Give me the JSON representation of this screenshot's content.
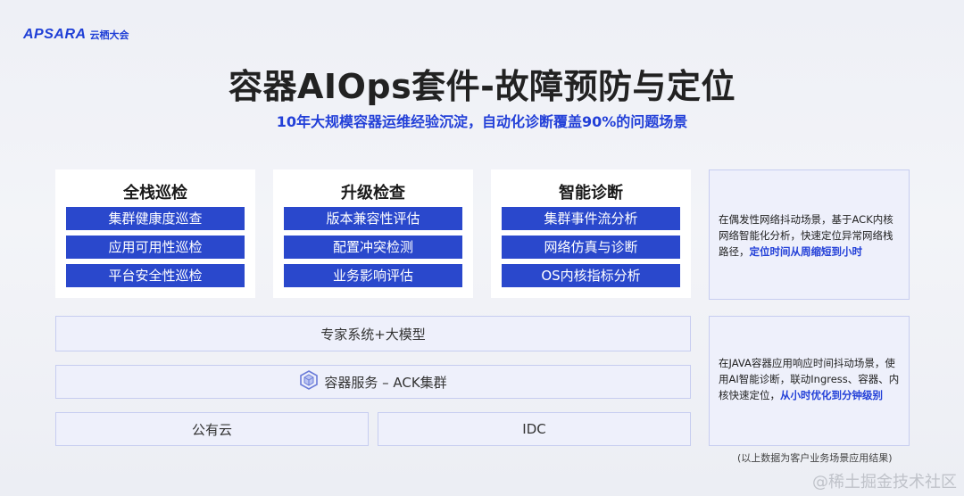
{
  "logo": {
    "brand": "APSARA",
    "event": "云栖大会"
  },
  "title": "容器AIOps套件-故障预防与定位",
  "subtitle": "10年大规模容器运维经验沉淀，自动化诊断覆盖90%的问题场景",
  "cards": [
    {
      "title": "全栈巡检",
      "items": [
        "集群健康度巡查",
        "应用可用性巡检",
        "平台安全性巡检"
      ]
    },
    {
      "title": "升级检查",
      "items": [
        "版本兼容性评估",
        "配置冲突检测",
        "业务影响评估"
      ]
    },
    {
      "title": "智能诊断",
      "items": [
        "集群事件流分析",
        "网络仿真与诊断",
        "OS内核指标分析"
      ]
    }
  ],
  "notes": [
    {
      "text": "在偶发性网络抖动场景，基于ACK内核网络智能化分析，快速定位异常网络栈路径，",
      "highlight": "定位时间从周缩短到小时"
    },
    {
      "text": "在JAVA容器应用响应时间抖动场景，使用AI智能诊断，联动Ingress、容器、内核快速定位，",
      "highlight": "从小时优化到分钟级别"
    }
  ],
  "layers": {
    "expert": "专家系统+大模型",
    "container_service": "容器服务 – ACK集群",
    "public_cloud": "公有云",
    "idc": "IDC"
  },
  "footnote": "(以上数据为客户业务场景应用结果)",
  "watermark": "@稀土掘金技术社区",
  "colors": {
    "accent": "#2a48cc",
    "highlight": "#2340d8",
    "panel_bg": "#eef0fb",
    "panel_border": "#c7cdf0"
  }
}
